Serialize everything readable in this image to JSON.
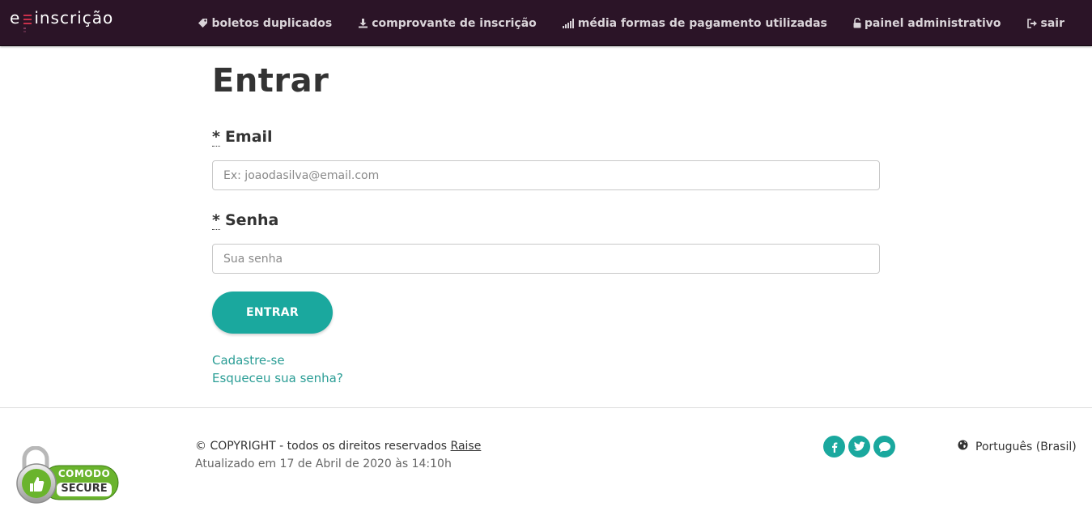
{
  "brand": {
    "prefix": "e",
    "name": "inscrição"
  },
  "nav": {
    "items": [
      {
        "label": "boletos duplicados",
        "icon": "tag-icon"
      },
      {
        "label": "comprovante de inscrição",
        "icon": "download-icon"
      },
      {
        "label": "média formas de pagamento utilizadas",
        "icon": "signal-icon"
      },
      {
        "label": "painel administrativo",
        "icon": "unlock-icon"
      },
      {
        "label": "sair",
        "icon": "sign-out-icon"
      }
    ]
  },
  "login": {
    "title": "Entrar",
    "required_mark": "*",
    "email_label": "Email",
    "email_placeholder": "Ex: joaodasilva@email.com",
    "email_value": "",
    "password_label": "Senha",
    "password_placeholder": "Sua senha",
    "password_value": "",
    "submit_label": "ENTRAR",
    "signup_link": "Cadastre-se",
    "forgot_link": "Esqueceu sua senha?"
  },
  "footer": {
    "copyright_prefix": "© COPYRIGHT - todos os direitos reservados",
    "copyright_link": "Raise",
    "updated": "Atualizado em 17 de Abril de 2020 às 14:10h",
    "badge_line1": "COMODO",
    "badge_line2": "SECURE",
    "socials": [
      {
        "icon": "facebook-icon",
        "glyph": "f"
      },
      {
        "icon": "twitter-icon",
        "glyph": "t"
      },
      {
        "icon": "chat-icon",
        "glyph": ""
      }
    ],
    "language": "Português (Brasil)"
  },
  "colors": {
    "navbar_bg": "#2b1427",
    "accent": "#1aa89e",
    "link": "#2a9d95",
    "brand_mark": "#c9304b",
    "badge_green": "#6ab42d"
  }
}
